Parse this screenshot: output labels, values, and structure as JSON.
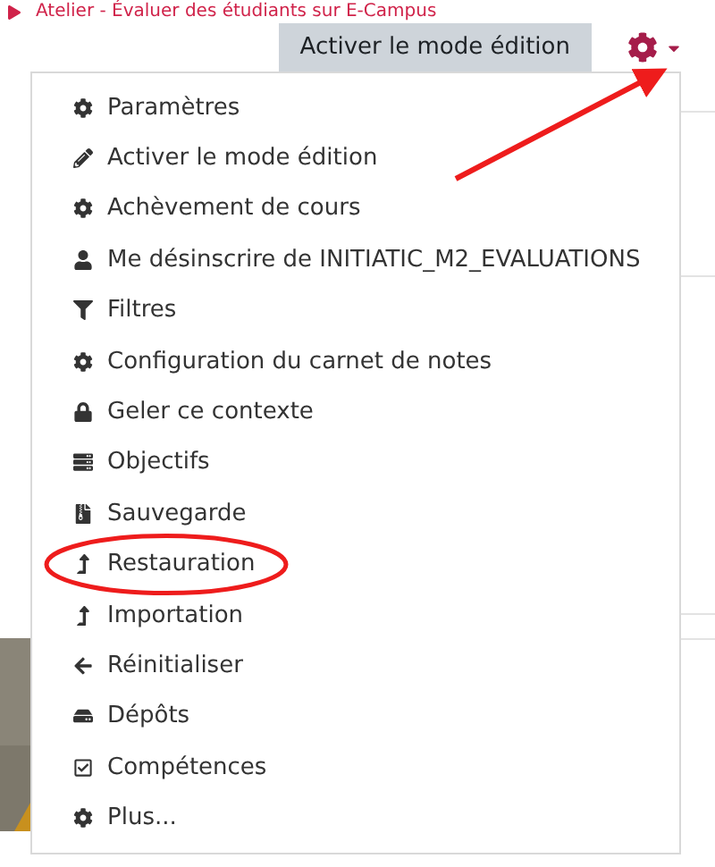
{
  "page_title": "Atelier - Évaluer des étudiants sur E-Campus",
  "edit_button": "Activer le mode édition",
  "menu": {
    "items": [
      {
        "label": "Paramètres"
      },
      {
        "label": "Activer le mode édition"
      },
      {
        "label": "Achèvement de cours"
      },
      {
        "label": "Me désinscrire de INITIATIC_M2_EVALUATIONS"
      },
      {
        "label": "Filtres"
      },
      {
        "label": "Configuration du carnet de notes"
      },
      {
        "label": "Geler ce contexte"
      },
      {
        "label": "Objectifs"
      },
      {
        "label": "Sauvegarde"
      },
      {
        "label": "Restauration",
        "circled": true
      },
      {
        "label": "Importation"
      },
      {
        "label": "Réinitialiser"
      },
      {
        "label": "Dépôts"
      },
      {
        "label": "Compétences"
      },
      {
        "label": "Plus..."
      }
    ]
  }
}
